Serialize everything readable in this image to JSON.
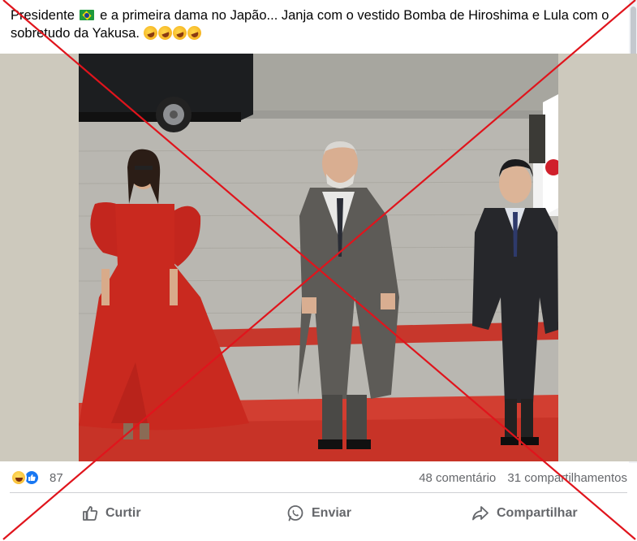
{
  "post": {
    "text_before_flag": "Presidente",
    "flag_icon": "brazil-flag-emoji",
    "text_after_flag": " e a primeira dama no Japão... Janja com o vestido Bomba de Hiroshima e Lula com o sobretudo da Yakusa.",
    "trailing_emojis": "rolling-on-floor-laughing-emoji x4"
  },
  "reactions": {
    "icons": [
      "haha-reaction-icon",
      "like-reaction-icon"
    ],
    "count": "87"
  },
  "stats": {
    "comments": "48 comentário",
    "shares": "31 compartilhamentos"
  },
  "actions": {
    "like_label": "Curtir",
    "send_label": "Enviar",
    "share_label": "Compartilhar"
  },
  "colors": {
    "overlay_cross": "#e0141c",
    "secondary_text": "#65676b",
    "like_blue": "#1877f2",
    "carpet_red": "#d63a2e"
  }
}
